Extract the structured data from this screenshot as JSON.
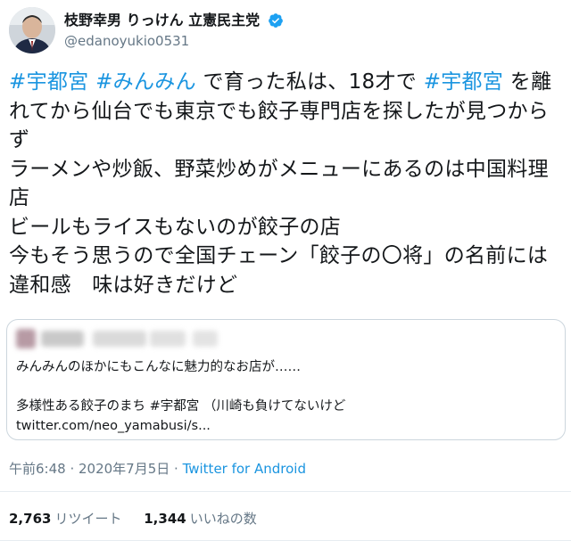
{
  "author": {
    "display_name": "枝野幸男 りっけん 立憲民主党",
    "handle": "@edanoyukio0531"
  },
  "tweet": {
    "parts": [
      {
        "text": "#宇都宮",
        "hashtag": true
      },
      {
        "text": " ",
        "hashtag": false
      },
      {
        "text": "#みんみん",
        "hashtag": true
      },
      {
        "text": " で育った私は、18才で ",
        "hashtag": false
      },
      {
        "text": "#宇都宮",
        "hashtag": true
      },
      {
        "text": " を離れてから仙台でも東京でも餃子専門店を探したが見つからず\nラーメンや炒飯、野菜炒めがメニューにあるのは中国料理店\nビールもライスもないのが餃子の店\n今もそう思うので全国チェーン「餃子の〇将」の名前には違和感　味は好きだけど",
        "hashtag": false
      }
    ]
  },
  "quoted": {
    "text": "みんみんのほかにもこんなに魅力的なお店が……\n\n多様性ある餃子のまち #宇都宮 （川崎も負けてないけど\ntwitter.com/neo_yamabusi/s..."
  },
  "meta": {
    "time": "午前6:48 · 2020年7月5日 · ",
    "source": "Twitter for Android"
  },
  "stats": {
    "retweets_count": "2,763",
    "retweets_label": "リツイート",
    "likes_count": "1,344",
    "likes_label": "いいねの数"
  },
  "colors": {
    "accent": "#1b95e0",
    "muted": "#657786",
    "text": "#14171a",
    "border": "#ccd6dd"
  },
  "icons": {
    "verified": "verified-badge-icon"
  }
}
